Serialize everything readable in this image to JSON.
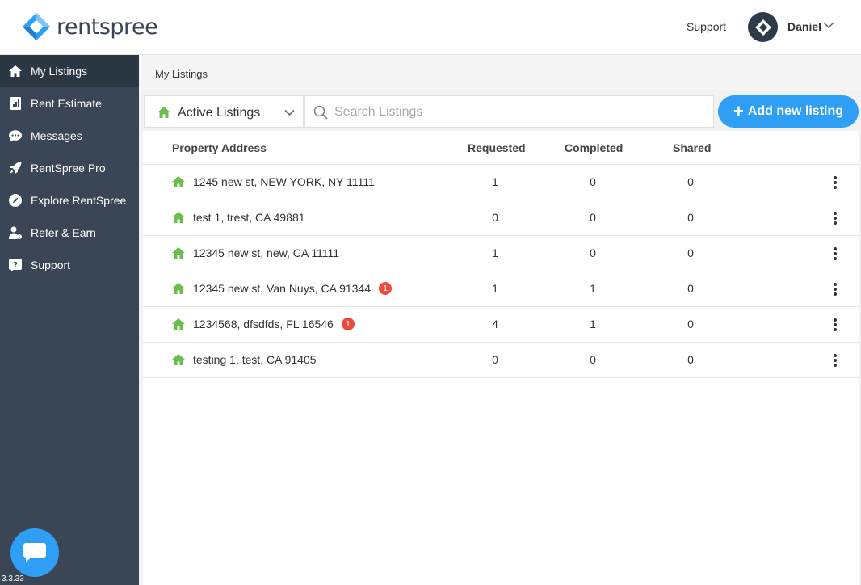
{
  "header": {
    "brand": "rentspree",
    "support_label": "Support",
    "user_name": "Daniel",
    "brand_color": "#2f9ef5"
  },
  "sidebar": {
    "items": [
      {
        "label": "My Listings",
        "icon": "home-icon",
        "active": true
      },
      {
        "label": "Rent Estimate",
        "icon": "chart-report-icon",
        "active": false
      },
      {
        "label": "Messages",
        "icon": "chat-icon",
        "active": false
      },
      {
        "label": "RentSpree Pro",
        "icon": "rocket-icon",
        "active": false
      },
      {
        "label": "Explore RentSpree",
        "icon": "compass-icon",
        "active": false
      },
      {
        "label": "Refer & Earn",
        "icon": "refer-user-icon",
        "active": false
      },
      {
        "label": "Support",
        "icon": "help-icon",
        "active": false
      }
    ],
    "version": "3.3.33"
  },
  "breadcrumb": "My Listings",
  "filter": {
    "selected": "Active Listings"
  },
  "search": {
    "placeholder": "Search Listings"
  },
  "add_button_label": "Add new listing",
  "table": {
    "headers": {
      "address": "Property Address",
      "requested": "Requested",
      "completed": "Completed",
      "shared": "Shared"
    },
    "rows": [
      {
        "address": "1245 new st, NEW YORK, NY 11111",
        "badge": "",
        "requested": "1",
        "completed": "0",
        "shared": "0"
      },
      {
        "address": "test 1, trest, CA 49881",
        "badge": "",
        "requested": "0",
        "completed": "0",
        "shared": "0"
      },
      {
        "address": "12345 new st, new, CA 11111",
        "badge": "",
        "requested": "1",
        "completed": "0",
        "shared": "0"
      },
      {
        "address": "12345 new st, Van Nuys, CA 91344",
        "badge": "1",
        "requested": "1",
        "completed": "1",
        "shared": "0"
      },
      {
        "address": "1234568, dfsdfds, FL 16546",
        "badge": "1",
        "requested": "4",
        "completed": "1",
        "shared": "0"
      },
      {
        "address": "testing 1, test, CA 91405",
        "badge": "",
        "requested": "0",
        "completed": "0",
        "shared": "0"
      }
    ]
  }
}
